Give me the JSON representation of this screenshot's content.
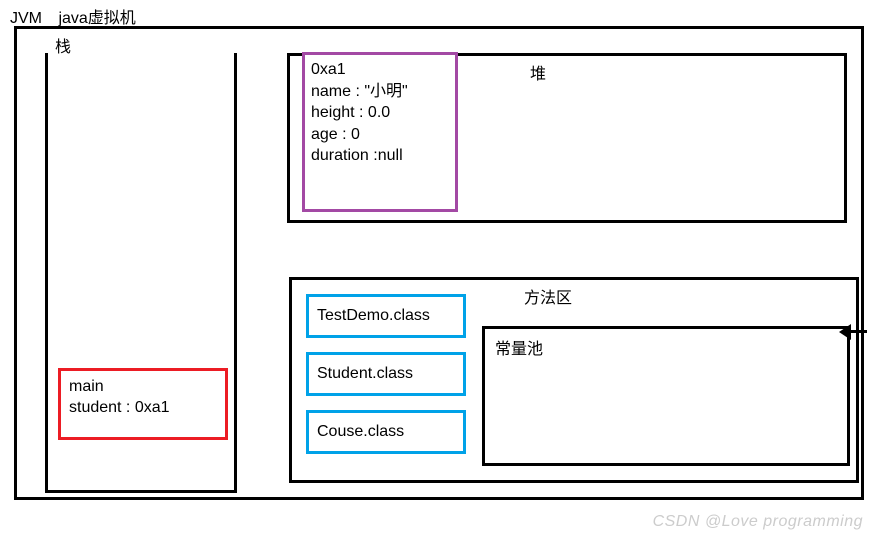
{
  "title": {
    "jvm": "JVM",
    "cn": "java虚拟机"
  },
  "stack": {
    "label": "栈",
    "main": {
      "line1": "main",
      "line2": "student : 0xa1"
    }
  },
  "heap": {
    "label": "堆",
    "object": {
      "addr": "0xa1",
      "name_line": "name : \"小明\"",
      "height_line": "height : 0.0",
      "age_line": "age : 0",
      "duration_line": "duration :null"
    }
  },
  "method_area": {
    "label": "方法区",
    "classes": [
      "TestDemo.class",
      "Student.class",
      "Couse.class"
    ],
    "const_pool": "常量池"
  },
  "watermark": "CSDN @Love programming"
}
